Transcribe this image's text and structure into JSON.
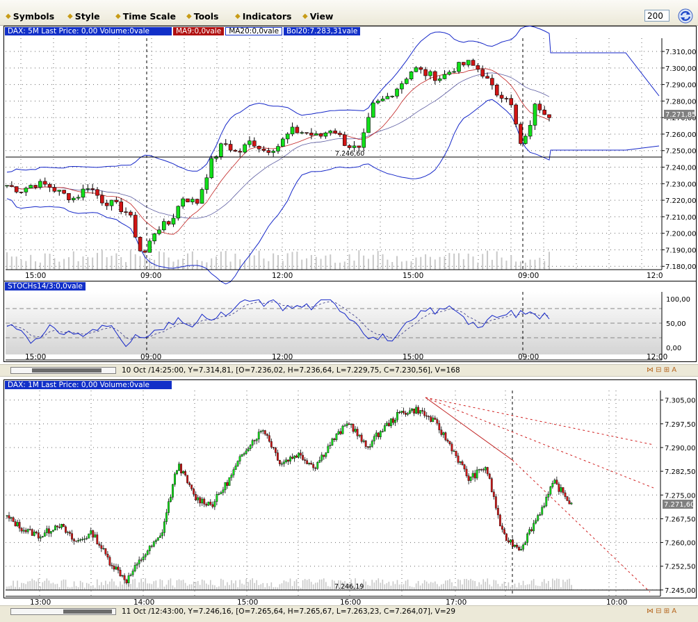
{
  "menu": {
    "items": [
      "Symbols",
      "Style",
      "Time Scale",
      "Tools",
      "Indicators",
      "View"
    ],
    "period_value": "200"
  },
  "top_chart": {
    "tags": {
      "main": "DAX: 5M Last Price: 0,00 Volume:0vale",
      "ma9": "MA9:0,0vale",
      "ma20": "MA20:0,0vale",
      "bol": "Bol20:7.283,31vale"
    },
    "y_ticks": [
      "7.310,00",
      "7.300,00",
      "7.290,00",
      "7.280,00",
      "7.270,00",
      "7.260,00",
      "7.250,00",
      "7.240,00",
      "7.230,00",
      "7.220,00",
      "7.210,00",
      "7.200,00",
      "7.190,00",
      "7.180,00"
    ],
    "last_price_label": "7.271,85",
    "hline_label": "7.246,60",
    "x_ticks": [
      "15:00",
      "09:00",
      "12:00",
      "15:00",
      "09:00",
      "12:0"
    ]
  },
  "stoch": {
    "tag": "STOCHs14/3:0,0vale",
    "y_ticks": [
      "100,00",
      "50,00",
      "0,00"
    ],
    "x_ticks": [
      "15:00",
      "09:00",
      "12:00",
      "15:00",
      "09:00",
      "12:00"
    ]
  },
  "status1": {
    "text": "10 Oct /14:25:00, Y=7.314,81, [O=7.236,02, H=7.236,64, L=7.229,75, C=7.230,56], V=168",
    "controls": "⋈ ⊟ ⊞ A"
  },
  "bottom_chart": {
    "tag": "DAX: 1M Last Price: 0,00 Volume:0vale",
    "y_ticks": [
      "7.305,00",
      "7.297,50",
      "7.290,00",
      "7.282,50",
      "7.275,00",
      "7.267,50",
      "7.260,00",
      "7.252,50",
      "7.245,00"
    ],
    "last_price_label": "7.271,60",
    "hline_label": "7.246,19",
    "x_ticks": [
      "13:00",
      "14:00",
      "15:00",
      "16:00",
      "17:00",
      "10:00"
    ]
  },
  "status2": {
    "text": "11 Oct /12:43:00, Y=7.246,16, [O=7.265,64, H=7.265,67, L=7.263,23, C=7.264,07], V=29",
    "controls": "⋈ ⊟ ⊞ A"
  },
  "chart_data": [
    {
      "type": "candlestick",
      "title": "DAX: 5M Last Price: 0,00 Volume:0vale",
      "ylim": [
        7178,
        7318
      ],
      "indicators": [
        "MA9",
        "MA20",
        "Bol20"
      ],
      "approx_close_path": [
        7229,
        7226,
        7230,
        7229,
        7224,
        7221,
        7229,
        7220,
        7217,
        7212,
        7185,
        7203,
        7206,
        7222,
        7218,
        7242,
        7255,
        7248,
        7256,
        7250,
        7253,
        7262,
        7261,
        7258,
        7264,
        7254,
        7250,
        7277,
        7282,
        7290,
        7300,
        7296,
        7294,
        7300,
        7303,
        7298,
        7285,
        7283,
        7250,
        7278,
        7272
      ]
    },
    {
      "type": "line",
      "title": "STOCHs14/3:0,0vale",
      "ylim": [
        0,
        100
      ]
    },
    {
      "type": "candlestick",
      "title": "DAX: 1M Last Price: 0,00 Volume:0vale",
      "ylim": [
        7244,
        7307
      ],
      "approx_close_path": [
        7268,
        7264,
        7262,
        7266,
        7260,
        7263,
        7254,
        7248,
        7256,
        7262,
        7285,
        7274,
        7272,
        7280,
        7290,
        7296,
        7285,
        7288,
        7284,
        7292,
        7298,
        7290,
        7296,
        7301,
        7302,
        7298,
        7290,
        7280,
        7284,
        7262,
        7258,
        7268,
        7279,
        7272
      ]
    }
  ]
}
